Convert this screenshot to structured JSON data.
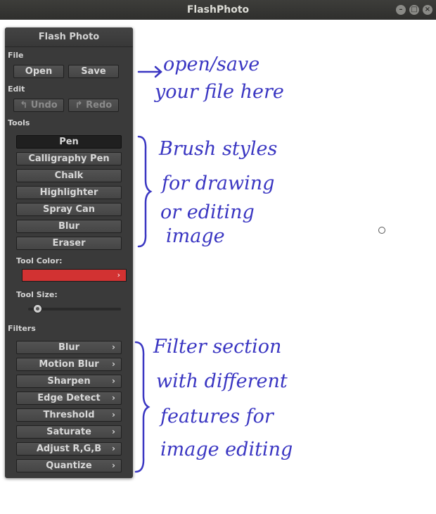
{
  "window": {
    "title": "FlashPhoto"
  },
  "panel": {
    "title": "Flash Photo",
    "sections": {
      "file": "File",
      "edit": "Edit",
      "tools": "Tools",
      "filters": "Filters"
    },
    "file_buttons": {
      "open": "Open",
      "save": "Save"
    },
    "edit_buttons": {
      "undo": "Undo",
      "redo": "Redo"
    },
    "tools": [
      "Pen",
      "Calligraphy Pen",
      "Chalk",
      "Highlighter",
      "Spray Can",
      "Blur",
      "Eraser"
    ],
    "active_tool": "Pen",
    "tool_color_label": "Tool Color:",
    "tool_color": "#d23232",
    "tool_size_label": "Tool Size:",
    "tool_size_level": 0.1,
    "filters": [
      "Blur",
      "Motion Blur",
      "Sharpen",
      "Edge Detect",
      "Threshold",
      "Saturate",
      "Adjust R,G,B",
      "Quantize"
    ]
  },
  "annotations": {
    "file": [
      "open/save",
      "your file here"
    ],
    "tools": [
      "Brush styles",
      "for drawing",
      "or editing",
      "image"
    ],
    "filters": [
      "Filter section",
      "with different",
      "features for",
      "image editing"
    ]
  },
  "icons": {
    "undo": "undo-arrow-icon",
    "redo": "redo-arrow-icon",
    "chevron": "chevron-right-icon",
    "window_controls": [
      "minimize-icon",
      "maximize-icon",
      "close-icon"
    ]
  },
  "colors": {
    "annotation_ink": "#3a36c2",
    "panel_bg": "#3a3a3a",
    "tool_color": "#d23232"
  }
}
